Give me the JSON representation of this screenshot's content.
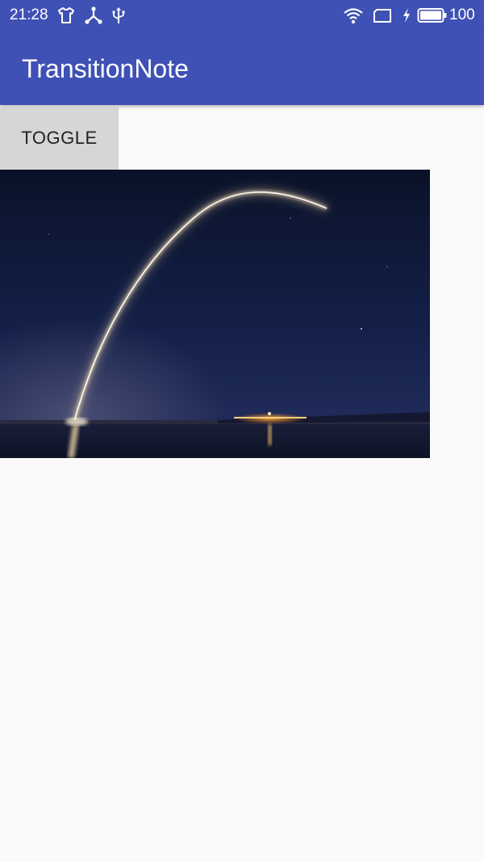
{
  "status_bar": {
    "time": "21:28",
    "battery_level": "100",
    "icons": [
      "tshirt-icon",
      "share-network-icon",
      "usb-icon",
      "wifi-icon",
      "screen-rotation-icon",
      "charging-bolt-icon",
      "battery-icon"
    ]
  },
  "app_bar": {
    "title": "TransitionNote",
    "color": "#3f51b5"
  },
  "main": {
    "toggle_label": "TOGGLE",
    "image": {
      "subject": "rocket-launch-night-photo"
    }
  }
}
